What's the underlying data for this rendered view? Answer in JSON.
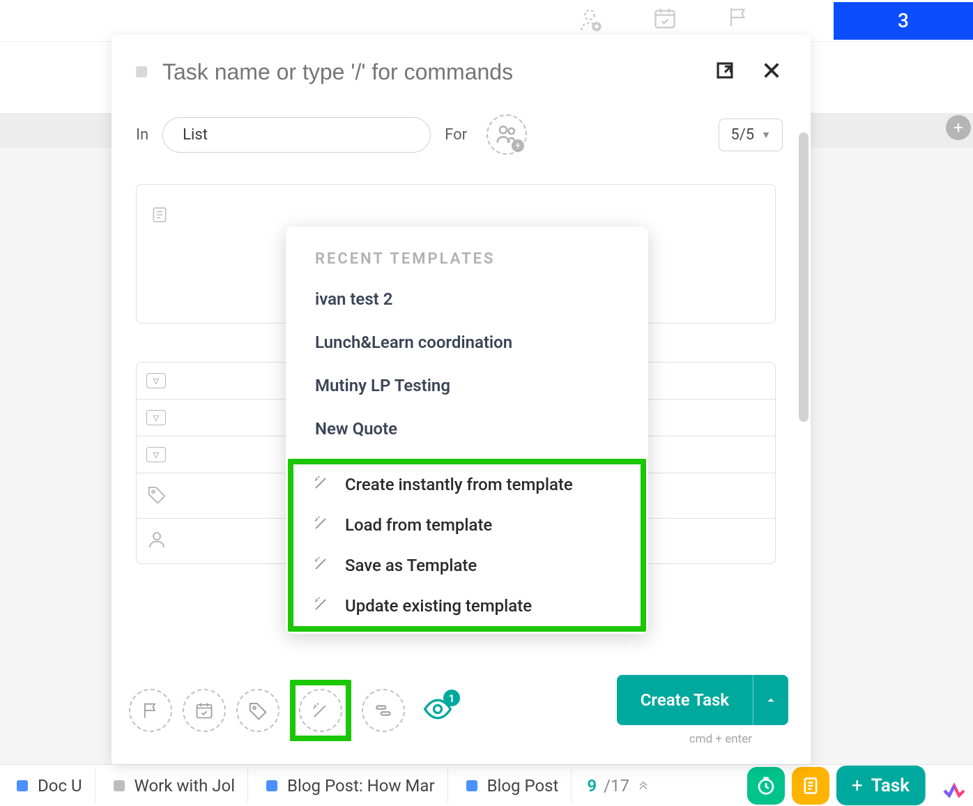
{
  "top_header": {
    "badge_count": "3"
  },
  "modal": {
    "task_name_placeholder": "Task name or type '/' for commands",
    "in_label": "In",
    "list_value": "List",
    "for_label": "For",
    "subtask_count": "5/5",
    "popover": {
      "section_title": "RECENT TEMPLATES",
      "recent_templates": [
        "ivan test 2",
        "Lunch&Learn coordination",
        "Mutiny LP Testing",
        "New Quote"
      ],
      "actions": [
        "Create instantly from template",
        "Load from template",
        "Save as Template",
        "Update existing template"
      ]
    },
    "eye_count": "1",
    "create_button": "Create Task",
    "shortcut_hint": "cmd + enter"
  },
  "bottom_bar": {
    "tabs": [
      "Doc U",
      "Work with Jol",
      "Blog Post: How Mar",
      "Blog Post"
    ],
    "counter_current": "9",
    "counter_total": "/17",
    "task_button": "Task"
  }
}
